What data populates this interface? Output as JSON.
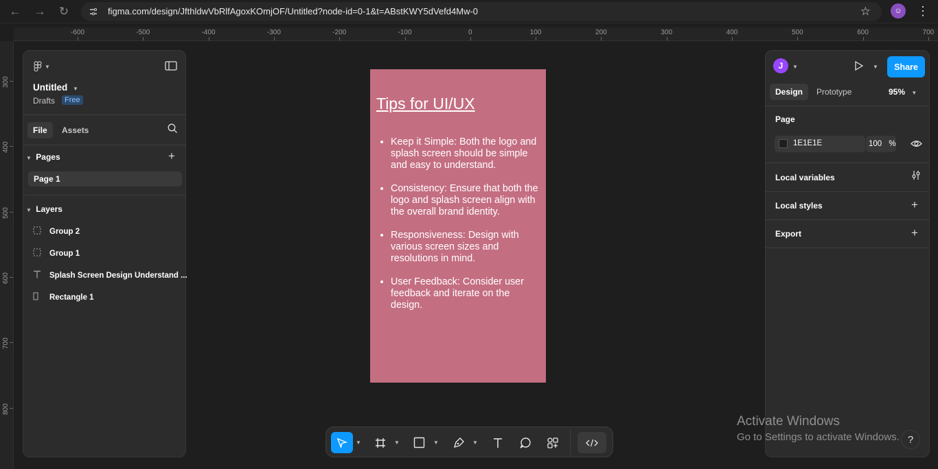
{
  "browser": {
    "url": "figma.com/design/JfthldwVbRlfAgoxKOmjOF/Untitled?node-id=0-1&t=ABstKWY5dVefd4Mw-0",
    "avatar_letter": "☺"
  },
  "rulers": {
    "top": [
      "-600",
      "-500",
      "-400",
      "-300",
      "-200",
      "-100",
      "0",
      "100",
      "200",
      "300",
      "400",
      "500",
      "600",
      "700"
    ],
    "left": [
      "300",
      "400",
      "500",
      "600",
      "700",
      "800"
    ]
  },
  "left_panel": {
    "file_name": "Untitled",
    "location": "Drafts",
    "plan_badge": "Free",
    "tabs": {
      "file": "File",
      "assets": "Assets"
    },
    "pages_heading": "Pages",
    "pages": [
      "Page 1"
    ],
    "layers_heading": "Layers",
    "layers": [
      {
        "name": "Group 2",
        "icon": "group-icon"
      },
      {
        "name": "Group 1",
        "icon": "group-icon"
      },
      {
        "name": "Splash Screen Design Understand ...",
        "icon": "text-layer-icon"
      },
      {
        "name": "Rectangle 1",
        "icon": "rectangle-layer-icon"
      }
    ]
  },
  "right_panel": {
    "user_initial": "J",
    "share_label": "Share",
    "tabs": {
      "design": "Design",
      "prototype": "Prototype"
    },
    "zoom": "95%",
    "page_heading": "Page",
    "bg_color_hex": "1E1E1E",
    "bg_opacity": "100",
    "bg_opacity_unit": "%",
    "sections": [
      "Local variables",
      "Local styles",
      "Export"
    ]
  },
  "frame": {
    "title": "Tips for UI/UX",
    "tips": [
      "Keep it Simple: Both the logo and splash screen should be simple and easy to understand.",
      "Consistency: Ensure that both the logo and splash screen align with the overall brand identity.",
      "Responsiveness: Design with various screen sizes and resolutions in mind.",
      "User Feedback: Consider user feedback and iterate on the design."
    ],
    "fill_color": "#c46e82"
  },
  "watermark": {
    "line1": "Activate Windows",
    "line2": "Go to Settings to activate Windows."
  },
  "help_label": "?",
  "colors": {
    "accent": "#0d99ff",
    "canvas": "#1e1e1e",
    "panel": "#2c2c2c",
    "avatar": "#9747ff"
  }
}
